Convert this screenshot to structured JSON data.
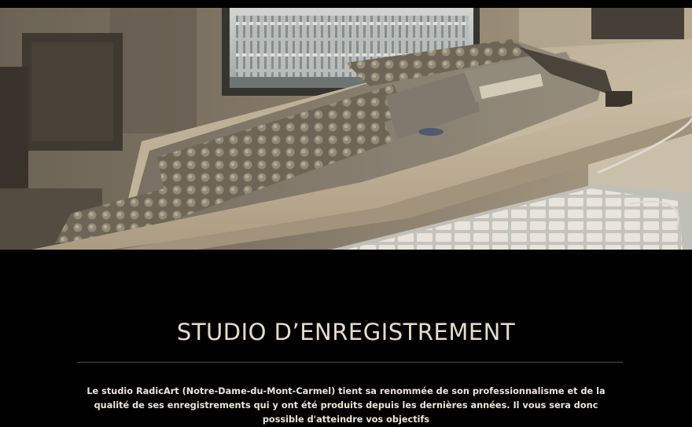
{
  "hero": {
    "image_icon": "studio-mixing-console-photo",
    "accent_color": "#b5a386"
  },
  "section": {
    "title": "STUDIO D’ENREGISTREMENT",
    "intro": "Le studio RadicArt (Notre-Dame-du-Mont-Carmel) tient sa renommée de son professionnalisme et de la qualité de ses enregistrements qui y ont été produits depuis les dernières années. Il vous sera donc possible d'atteindre vos objectifs"
  },
  "colors": {
    "background": "#000000",
    "title": "#e4dccb",
    "text": "#ece6d8",
    "divider": "#4a4a4a"
  }
}
